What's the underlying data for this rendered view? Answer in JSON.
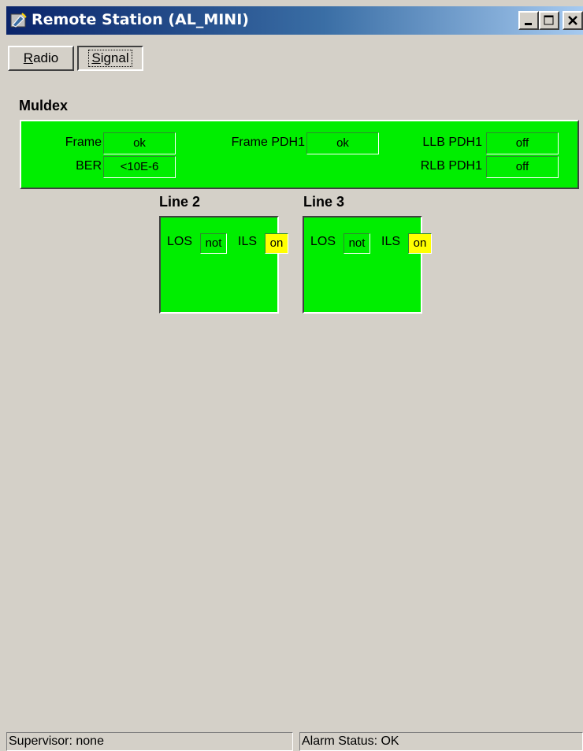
{
  "window": {
    "title": "Remote Station (AL_MINI)",
    "icon": "app-icon"
  },
  "tabs": [
    {
      "label": "Radio",
      "mnemonic": "R",
      "rest": "adio",
      "selected": false
    },
    {
      "label": "Signal",
      "mnemonic": "S",
      "rest": "ignal",
      "selected": true
    }
  ],
  "muldex": {
    "title": "Muldex",
    "frame_label": "Frame",
    "frame_value": "ok",
    "ber_label": "BER",
    "ber_value": "<10E-6",
    "frame_pdh1_label": "Frame PDH1",
    "frame_pdh1_value": "ok",
    "llb_pdh1_label": "LLB PDH1",
    "llb_pdh1_value": "off",
    "rlb_pdh1_label": "RLB PDH1",
    "rlb_pdh1_value": "off"
  },
  "lines": [
    {
      "title": "Line 2",
      "los_label": "LOS",
      "los_value": "not",
      "ils_label": "ILS",
      "ils_value": "on"
    },
    {
      "title": "Line 3",
      "los_label": "LOS",
      "los_value": "not",
      "ils_label": "ILS",
      "ils_value": "on"
    }
  ],
  "status_bar": {
    "supervisor": "Supervisor: none",
    "alarm_status": "Alarm Status: OK"
  },
  "colors": {
    "status_ok": "#00ee00",
    "indicator_on": "#ffff00",
    "title_bar": "#0a246a"
  }
}
